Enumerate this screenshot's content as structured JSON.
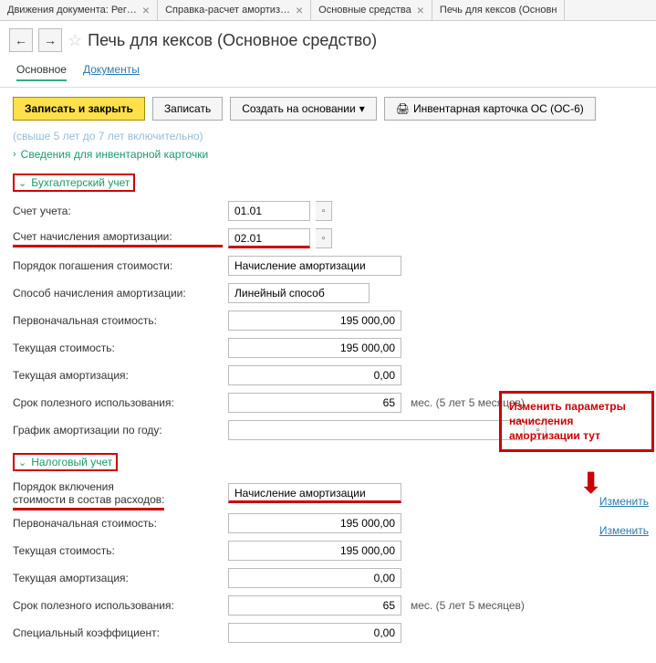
{
  "tabs": [
    {
      "label": "Движения документа: Рег…"
    },
    {
      "label": "Справка-расчет амортиз…"
    },
    {
      "label": "Основные средства"
    },
    {
      "label": "Печь для кексов (Основн"
    }
  ],
  "page_title": "Печь для кексов (Основное средство)",
  "subtabs": {
    "main": "Основное",
    "docs": "Документы"
  },
  "toolbar": {
    "save_close": "Записать и закрыть",
    "save": "Записать",
    "create_based": "Создать на основании",
    "inventory_card": "Инвентарная карточка ОС (ОС-6)"
  },
  "faded_text": "(свыше 5 лет до 7 лет включительно)",
  "disclosures": {
    "inventory_info": "Сведения для инвентарной карточки",
    "accounting": "Бухгалтерский учет",
    "tax": "Налоговый учет"
  },
  "accounting": {
    "account_label": "Счет учета:",
    "account_val": "01.01",
    "deprec_account_label": "Счет начисления амортизации:",
    "deprec_account_val": "02.01",
    "repayment_label": "Порядок погашения стоимости:",
    "repayment_val": "Начисление амортизации",
    "method_label": "Способ начисления амортизации:",
    "method_val": "Линейный способ",
    "initial_cost_label": "Первоначальная стоимость:",
    "initial_cost_val": "195 000,00",
    "current_cost_label": "Текущая стоимость:",
    "current_cost_val": "195 000,00",
    "current_deprec_label": "Текущая амортизация:",
    "current_deprec_val": "0,00",
    "useful_life_label": "Срок полезного использования:",
    "useful_life_val": "65",
    "useful_life_unit": "мес. (5 лет 5 месяцев)",
    "schedule_label": "График амортизации по году:",
    "schedule_val": ""
  },
  "tax": {
    "inclusion_label1": "Порядок включения",
    "inclusion_label2": "стоимости в состав расходов:",
    "inclusion_val": "Начисление амортизации",
    "initial_cost_label": "Первоначальная стоимость:",
    "initial_cost_val": "195 000,00",
    "current_cost_label": "Текущая стоимость:",
    "current_cost_val": "195 000,00",
    "current_deprec_label": "Текущая амортизация:",
    "current_deprec_val": "0,00",
    "useful_life_label": "Срок полезного использования:",
    "useful_life_val": "65",
    "useful_life_unit": "мес. (5 лет 5 месяцев)",
    "special_coef_label": "Специальный коэффициент:",
    "special_coef_val": "0,00"
  },
  "annotation": {
    "l1": "Изменить параметры",
    "l2": "начисления",
    "l3": "амортизации тут"
  },
  "change_link": "Изменить"
}
